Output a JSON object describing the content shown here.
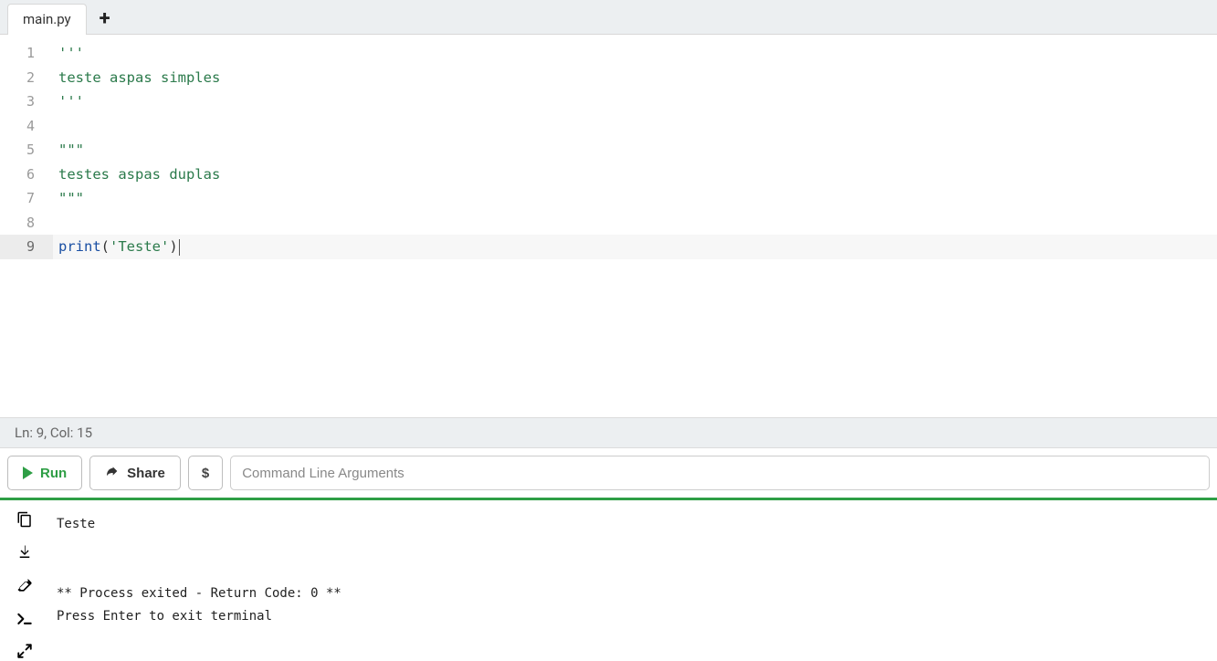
{
  "tabs": {
    "active": "main.py"
  },
  "editor": {
    "lines": [
      {
        "n": 1,
        "tokens": [
          {
            "t": "'''",
            "cls": "tok-str"
          }
        ]
      },
      {
        "n": 2,
        "tokens": [
          {
            "t": "teste aspas simples",
            "cls": "tok-str"
          }
        ]
      },
      {
        "n": 3,
        "tokens": [
          {
            "t": "'''",
            "cls": "tok-str"
          }
        ]
      },
      {
        "n": 4,
        "tokens": []
      },
      {
        "n": 5,
        "tokens": [
          {
            "t": "\"\"\"",
            "cls": "tok-str"
          }
        ]
      },
      {
        "n": 6,
        "tokens": [
          {
            "t": "testes aspas duplas",
            "cls": "tok-str"
          }
        ]
      },
      {
        "n": 7,
        "tokens": [
          {
            "t": "\"\"\"",
            "cls": "tok-str"
          }
        ]
      },
      {
        "n": 8,
        "tokens": []
      },
      {
        "n": 9,
        "tokens": [
          {
            "t": "print",
            "cls": "tok-fn"
          },
          {
            "t": "(",
            "cls": ""
          },
          {
            "t": "'Teste'",
            "cls": "tok-str"
          },
          {
            "t": ")",
            "cls": ""
          }
        ],
        "active": true
      }
    ],
    "activeLine": 9
  },
  "status": {
    "text": "Ln: 9,  Col: 15"
  },
  "actions": {
    "run": "Run",
    "share": "Share",
    "dollar": "$",
    "cmd_placeholder": "Command Line Arguments"
  },
  "terminal": {
    "output": "Teste\n\n\n** Process exited - Return Code: 0 **\nPress Enter to exit terminal"
  }
}
